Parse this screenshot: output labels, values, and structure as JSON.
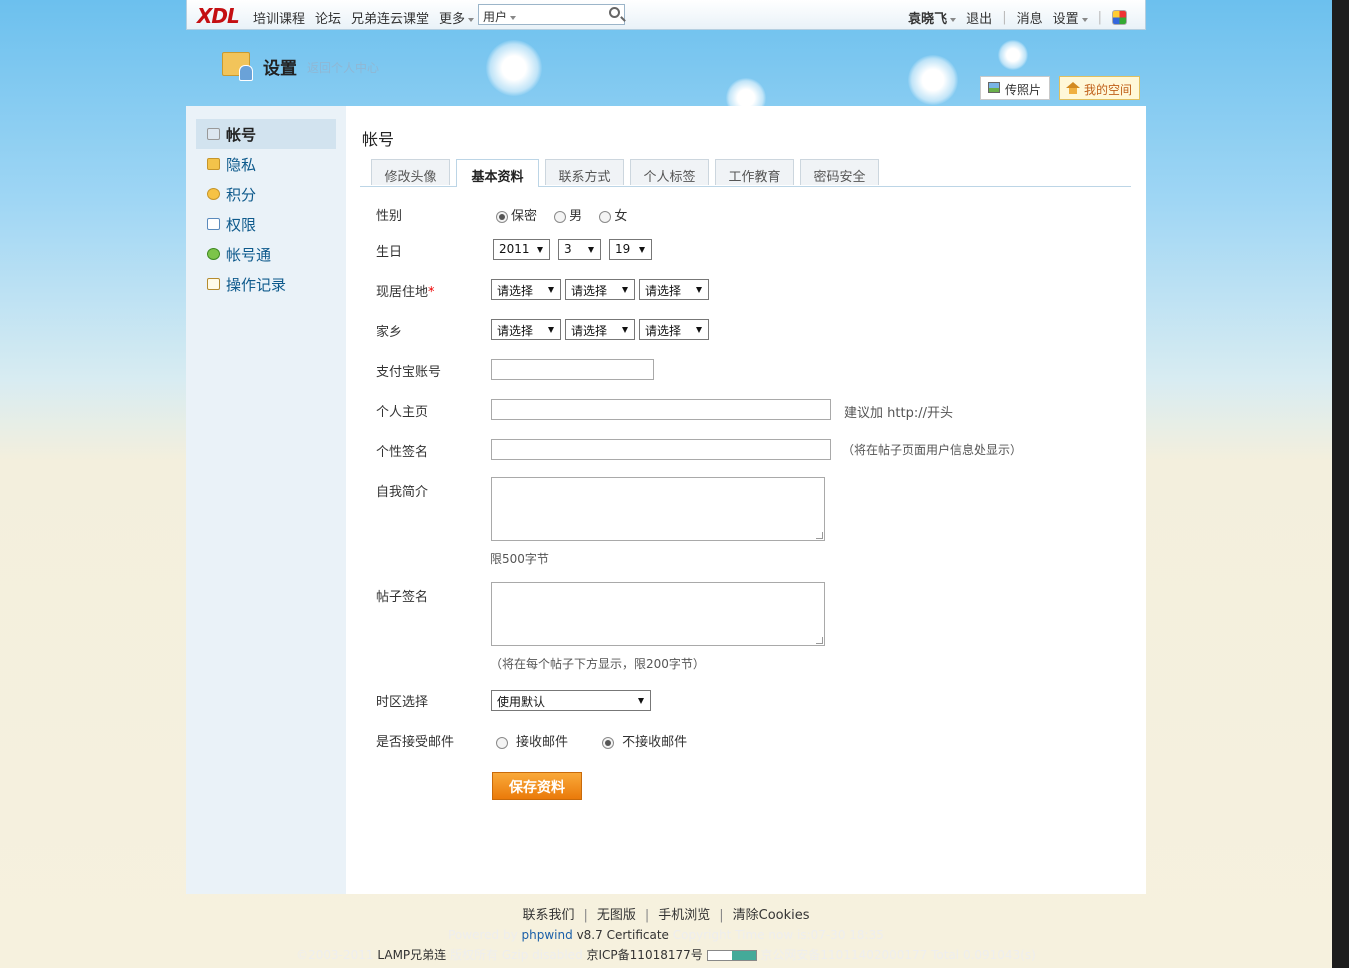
{
  "topbar": {
    "logo": "XDL",
    "nav": [
      "培训课程",
      "论坛",
      "兄弟连云课堂",
      "更多"
    ],
    "search_category": "用户",
    "username": "袁晓飞",
    "logout": "退出",
    "messages": "消息",
    "settings": "设置"
  },
  "header": {
    "title": "设置",
    "back_link": "返回个人中心",
    "upload_photo": "传照片",
    "my_space": "我的空间"
  },
  "sidebar": {
    "items": [
      {
        "label": "帐号",
        "icon": "account-card-icon",
        "active": true
      },
      {
        "label": "隐私",
        "icon": "lock-icon"
      },
      {
        "label": "积分",
        "icon": "coins-icon"
      },
      {
        "label": "权限",
        "icon": "permission-icon"
      },
      {
        "label": "帐号通",
        "icon": "sync-icon"
      },
      {
        "label": "操作记录",
        "icon": "edit-log-icon"
      }
    ]
  },
  "main": {
    "title": "帐号",
    "tabs": [
      "修改头像",
      "基本资料",
      "联系方式",
      "个人标签",
      "工作教育",
      "密码安全"
    ],
    "active_tab": "基本资料",
    "form": {
      "gender_label": "性别",
      "gender_options": [
        "保密",
        "男",
        "女"
      ],
      "gender_selected": "保密",
      "birthday_label": "生日",
      "birthday_year": "2011",
      "birthday_month": "3",
      "birthday_day": "19",
      "residence_label": "现居住地",
      "residence_required": "*",
      "select_placeholder": "请选择",
      "hometown_label": "家乡",
      "alipay_label": "支付宝账号",
      "alipay_value": "",
      "homepage_label": "个人主页",
      "homepage_value": "",
      "homepage_hint": "建议加 http://开头",
      "signature_label": "个性签名",
      "signature_value": "",
      "signature_hint": "（将在帖子页面用户信息处显示）",
      "intro_label": "自我简介",
      "intro_hint": "限500字节",
      "post_sig_label": "帖子签名",
      "post_sig_hint": "（将在每个帖子下方显示，限200字节）",
      "timezone_label": "时区选择",
      "timezone_value": "使用默认",
      "email_label": "是否接受邮件",
      "email_options": [
        "接收邮件",
        "不接收邮件"
      ],
      "email_selected": "不接收邮件",
      "save_button": "保存资料"
    }
  },
  "footer": {
    "links": [
      "联系我们",
      "无图版",
      "手机浏览",
      "清除Cookies"
    ],
    "powered_prefix": "Powered by",
    "powered_link": "phpwind",
    "powered_version": "v8.7",
    "certificate": "Certificate",
    "copyright_time": "Copyright Time now is:07-30 18:35",
    "copyright_years": "©2003-2011",
    "site_name": "LAMP兄弟连",
    "rights": "版权所有 Gzip disabled",
    "icp": "京ICP备11018177号",
    "police": "京公网安备11011402000177 Total 0.091043(s)"
  },
  "colors": {
    "accent_orange": "#ea7a0a",
    "link_blue": "#0e5a8c",
    "logo_red": "#c40f12"
  }
}
